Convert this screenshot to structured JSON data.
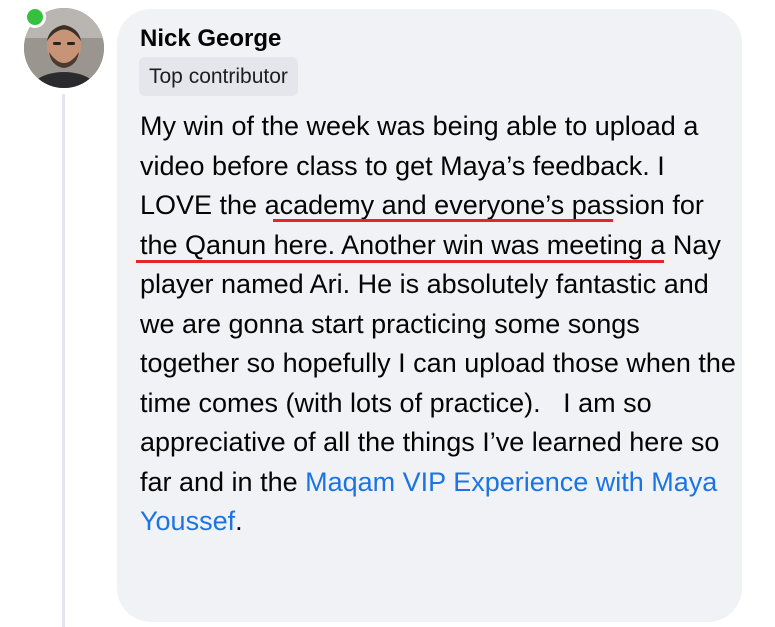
{
  "comment": {
    "author": "Nick George",
    "badge": "Top contributor",
    "body": {
      "part1": "My win of the week was being able to upload a video before class to get Maya’s feedback.",
      "highlight": " I LOVE the academy and everyone’s passion for the Qanun here",
      "part2": ". Another win was meeting a Nay player named Ari. He is absolutely fantastic and we are gonna start practicing some songs together so hopefully I can upload those when the time comes (with lots of practice).   I am so appreciative of all the things I’ve learned here so far and in the ",
      "link": "Maqam VIP Experience with Maya Youssef",
      "end": "."
    }
  },
  "colors": {
    "bubble_background": "#f0f2f5",
    "badge_background": "#e4e6eb",
    "link": "#1b74e4",
    "underline_annotation": "#e3262b",
    "online_indicator": "#35c13e"
  },
  "icons": {
    "avatar": "user-profile-photo",
    "presence": "online-status-dot"
  }
}
